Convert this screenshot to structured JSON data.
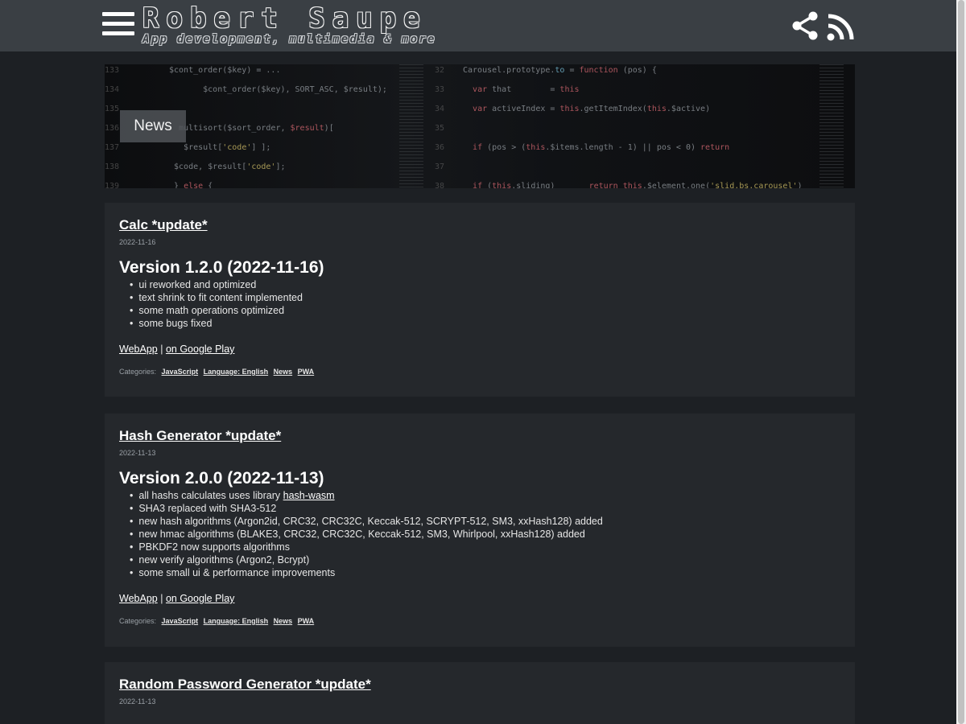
{
  "header": {
    "title": "Robert Saupe",
    "subtitle": "App development, multimedia & more",
    "icons": {
      "menu": "menu-icon",
      "share": "share-icon",
      "rss": "rss-icon"
    }
  },
  "hero": {
    "label": "News"
  },
  "posts": [
    {
      "title": "Calc *update*",
      "date": "2022-11-16",
      "version": "Version 1.2.0 (2022-11-16)",
      "items": [
        "ui reworked and optimized",
        "text shrink to fit content implemented",
        "some math operations optimized",
        "some bugs fixed"
      ],
      "links": {
        "webapp": "WebApp",
        "separator": "|",
        "play": "on Google Play"
      },
      "categories_label": "Categories:",
      "categories": [
        "JavaScript",
        "Language: English",
        "News",
        "PWA"
      ]
    },
    {
      "title": "Hash Generator *update*",
      "date": "2022-11-13",
      "version": "Version 2.0.0 (2022-11-13)",
      "item_first_prefix": "all hashs calculates uses library",
      "item_first_link": "hash-wasm",
      "items": [
        "SHA3 replaced with SHA3-512",
        "new hash algorithms (Argon2id, CRC32, CRC32C, Keccak-512, SCRYPT-512, SM3, xxHash128) added",
        "new hmac algorithms (BLAKE3, CRC32, CRC32C, Keccak-512, SM3, Whirlpool, xxHash128) added",
        "PBKDF2 now supports algorithms",
        "new verify algorithms (Argon2, Bcrypt)",
        "some small ui & performance improvements"
      ],
      "links": {
        "webapp": "WebApp",
        "separator": "|",
        "play": "on Google Play"
      },
      "categories_label": "Categories:",
      "categories": [
        "JavaScript",
        "Language: English",
        "News",
        "PWA"
      ]
    },
    {
      "title": "Random Password Generator *update*",
      "date": "2022-11-13"
    }
  ],
  "colors": {
    "topbar": "#3a3f44",
    "background": "#1d2024",
    "card": "#25282c"
  }
}
